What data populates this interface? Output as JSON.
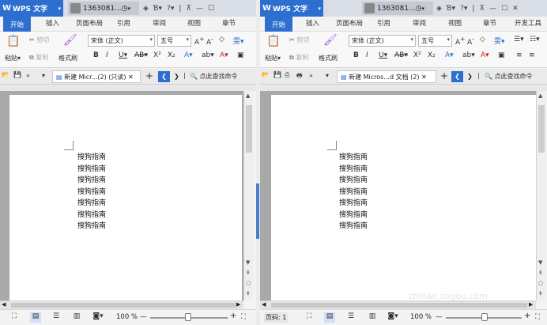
{
  "app": {
    "logo_letter": "W",
    "name": "WPS 文字",
    "dropdown": "▾"
  },
  "windows": [
    {
      "user": "1363081...",
      "tabs": [
        "开始",
        "插入",
        "页面布局",
        "引用",
        "审阅",
        "视图",
        "章节"
      ],
      "active_tab": "开始",
      "font": "宋体 (正文)",
      "size": "五号",
      "paste": "粘贴",
      "cut": "剪切",
      "copy": "复制",
      "painter": "格式刷",
      "doc_tab": "新建 Micr...(2) (只读)",
      "find": "点此查找命令",
      "lines": [
        "搜狗指南",
        "搜狗指南",
        "搜狗指南",
        "搜狗指南",
        "搜狗指南",
        "搜狗指南",
        "搜狗指南"
      ],
      "zoom": "100 %"
    },
    {
      "user": "1363081...",
      "tabs": [
        "开始",
        "插入",
        "页面布局",
        "引用",
        "审阅",
        "视图",
        "章节",
        "开发工具"
      ],
      "active_tab": "开始",
      "font": "宋体 (正文)",
      "size": "五号",
      "paste": "粘贴",
      "cut": "剪切",
      "copy": "复制",
      "painter": "格式刷",
      "doc_tab": "新建 Micros...d 文档 (2)",
      "find": "点此查找命令",
      "lines": [
        "搜狗指南",
        "搜狗指南",
        "搜狗指南",
        "搜狗指南",
        "搜狗指南",
        "搜狗指南",
        "搜狗指南"
      ],
      "zoom": "100 %",
      "page_label": "页码: 1"
    }
  ],
  "watermark": {
    "text": "搜狗指南",
    "url": "zhinan.sogou.com"
  },
  "colors": {
    "accent": "#2d6fd0",
    "doc_bg": "#a9a9a9",
    "titlebar": "#d8dde6"
  }
}
